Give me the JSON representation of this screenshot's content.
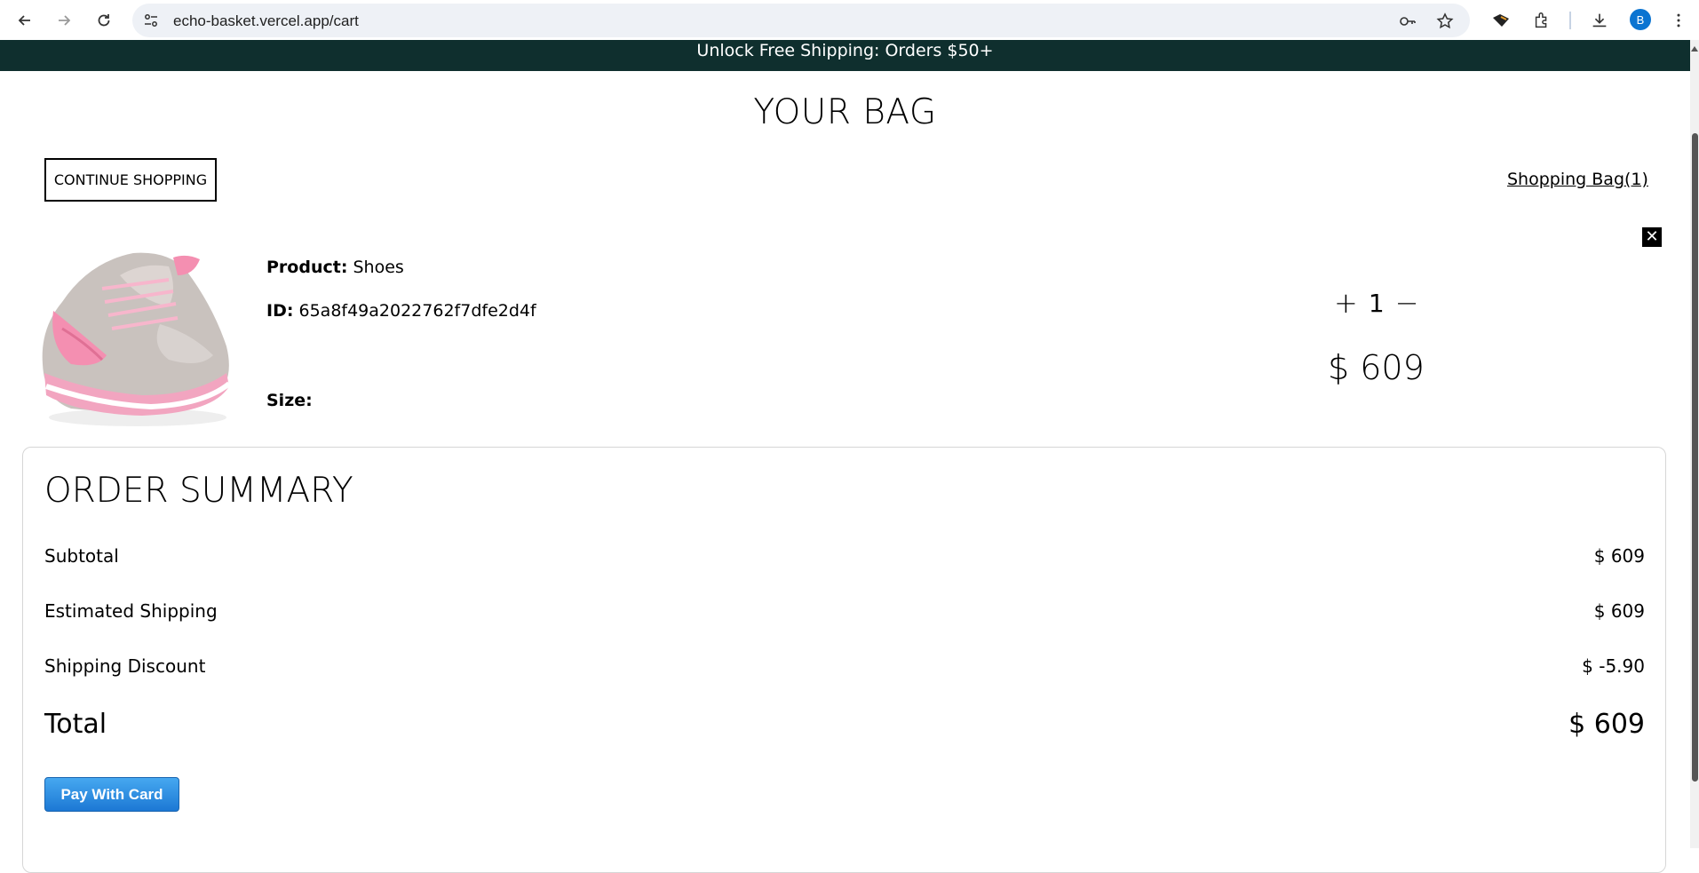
{
  "browser": {
    "url": "echo-basket.vercel.app/cart",
    "profile_initial": "B"
  },
  "announcement": "Unlock Free Shipping: Orders $50+",
  "page_title": "YOUR BAG",
  "continue_label": "CONTINUE SHOPPING",
  "bag_link": "Shopping Bag(1)",
  "remove_icon": "close-icon",
  "product": {
    "product_label": "Product:",
    "product_value": "Shoes",
    "id_label": "ID:",
    "id_value": "65a8f49a2022762f7dfe2d4f",
    "size_label": "Size:",
    "quantity": "1",
    "plus": "+",
    "minus": "−",
    "price": "$ 609"
  },
  "summary": {
    "title": "ORDER SUMMARY",
    "rows": [
      {
        "label": "Subtotal",
        "value": "$ 609"
      },
      {
        "label": "Estimated Shipping",
        "value": "$ 609"
      },
      {
        "label": "Shipping Discount",
        "value": "$ -5.90"
      }
    ],
    "total_label": "Total",
    "total_value": "$ 609",
    "pay_label": "Pay With Card"
  },
  "colors": {
    "announce_bg": "#0f2f2e",
    "pay_button": "#1c78d4",
    "avatar": "#0b74d1"
  }
}
